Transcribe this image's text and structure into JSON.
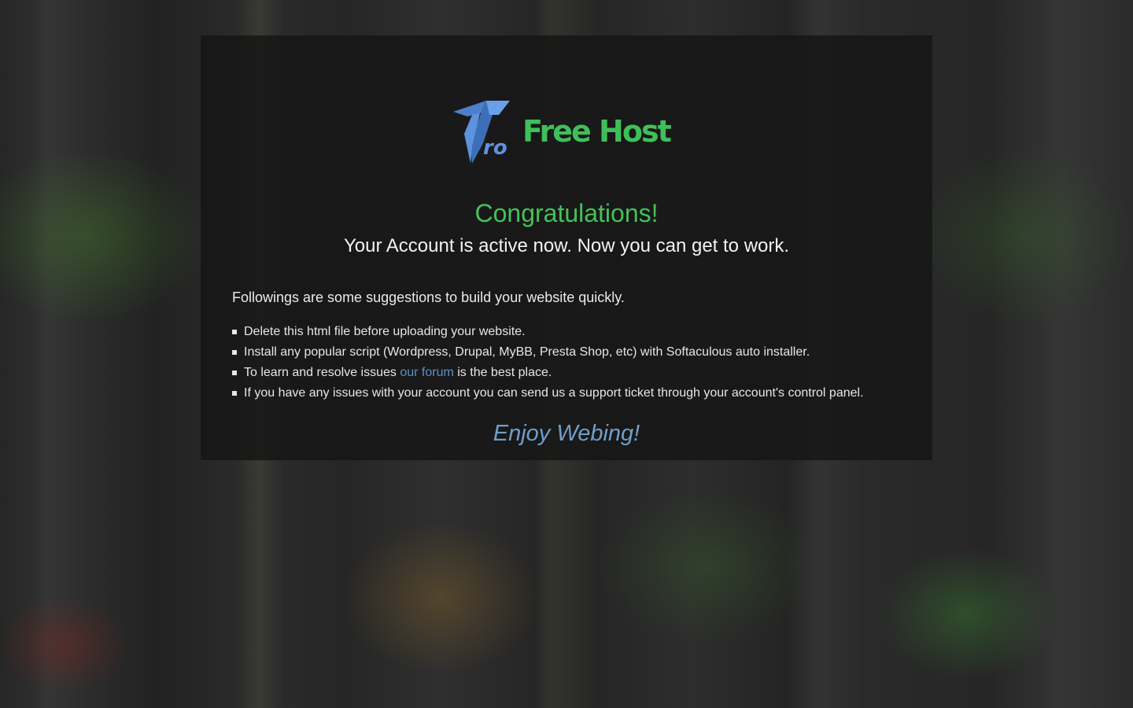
{
  "brand": {
    "logo_mark_text": "ro",
    "name": "Free Host",
    "logo_color": "#4a7fd0",
    "name_color": "#3fbf5a"
  },
  "main": {
    "title": "Congratulations!",
    "subtitle": "Your Account is active now. Now you can get to work.",
    "intro": "Followings are some suggestions to build your website quickly.",
    "suggestions": [
      {
        "text": "Delete this html file before uploading your website."
      },
      {
        "text": "Install any popular script (Wordpress, Drupal, MyBB, Presta Shop, etc) with Softaculous auto installer."
      },
      {
        "before": "To learn and resolve issues ",
        "link": "our forum",
        "after": " is the best place."
      },
      {
        "text": "If you have any issues with your account you can send us a support ticket through your account's control panel."
      }
    ],
    "closing": "Enjoy Webing!"
  },
  "colors": {
    "accent_green": "#44c158",
    "link_blue": "#5b8fc8",
    "panel_bg": "rgba(22,22,22,0.86)"
  }
}
